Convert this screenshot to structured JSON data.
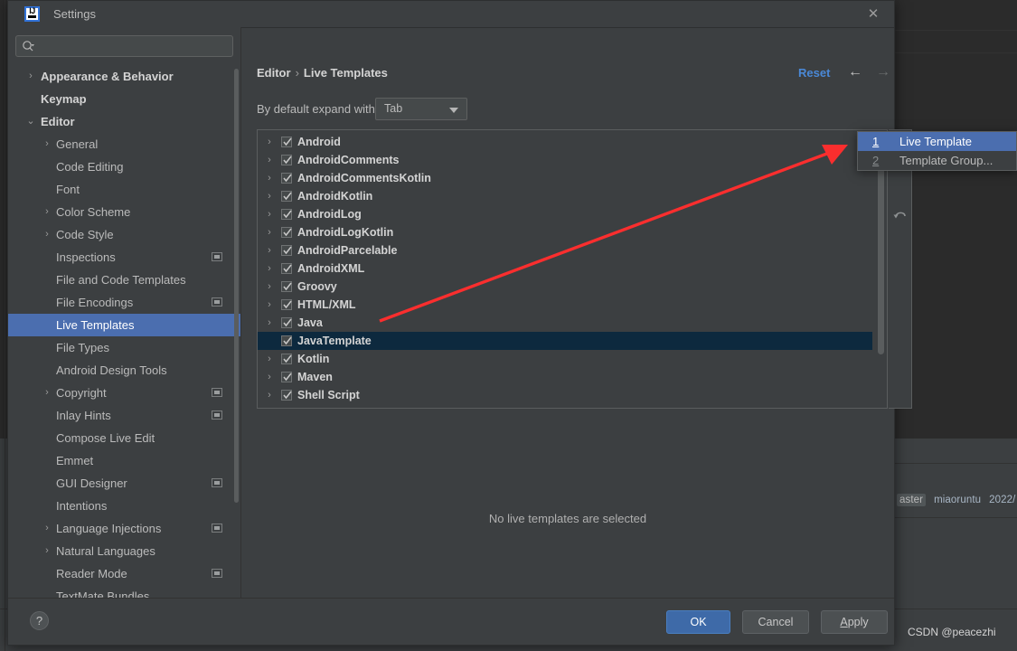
{
  "window": {
    "title": "Settings",
    "logo_text": "IJ",
    "close_icon": "✕"
  },
  "search": {
    "value": "",
    "placeholder": ""
  },
  "sidebar": {
    "items": [
      {
        "label": "Appearance & Behavior",
        "level": 0,
        "arrow": "›",
        "badge": false,
        "selected": false
      },
      {
        "label": "Keymap",
        "level": 0,
        "arrow": "",
        "badge": false,
        "selected": false
      },
      {
        "label": "Editor",
        "level": 0,
        "arrow": "⌄",
        "badge": false,
        "selected": false
      },
      {
        "label": "General",
        "level": 1,
        "arrow": "›",
        "badge": false,
        "selected": false
      },
      {
        "label": "Code Editing",
        "level": 1,
        "arrow": "",
        "badge": false,
        "selected": false
      },
      {
        "label": "Font",
        "level": 1,
        "arrow": "",
        "badge": false,
        "selected": false
      },
      {
        "label": "Color Scheme",
        "level": 1,
        "arrow": "›",
        "badge": false,
        "selected": false
      },
      {
        "label": "Code Style",
        "level": 1,
        "arrow": "›",
        "badge": false,
        "selected": false
      },
      {
        "label": "Inspections",
        "level": 1,
        "arrow": "",
        "badge": true,
        "selected": false
      },
      {
        "label": "File and Code Templates",
        "level": 1,
        "arrow": "",
        "badge": false,
        "selected": false
      },
      {
        "label": "File Encodings",
        "level": 1,
        "arrow": "",
        "badge": true,
        "selected": false
      },
      {
        "label": "Live Templates",
        "level": 1,
        "arrow": "",
        "badge": false,
        "selected": true
      },
      {
        "label": "File Types",
        "level": 1,
        "arrow": "",
        "badge": false,
        "selected": false
      },
      {
        "label": "Android Design Tools",
        "level": 1,
        "arrow": "",
        "badge": false,
        "selected": false
      },
      {
        "label": "Copyright",
        "level": 1,
        "arrow": "›",
        "badge": true,
        "selected": false
      },
      {
        "label": "Inlay Hints",
        "level": 1,
        "arrow": "",
        "badge": true,
        "selected": false
      },
      {
        "label": "Compose Live Edit",
        "level": 1,
        "arrow": "",
        "badge": false,
        "selected": false
      },
      {
        "label": "Emmet",
        "level": 1,
        "arrow": "",
        "badge": false,
        "selected": false
      },
      {
        "label": "GUI Designer",
        "level": 1,
        "arrow": "",
        "badge": true,
        "selected": false
      },
      {
        "label": "Intentions",
        "level": 1,
        "arrow": "",
        "badge": false,
        "selected": false
      },
      {
        "label": "Language Injections",
        "level": 1,
        "arrow": "›",
        "badge": true,
        "selected": false
      },
      {
        "label": "Natural Languages",
        "level": 1,
        "arrow": "›",
        "badge": false,
        "selected": false
      },
      {
        "label": "Reader Mode",
        "level": 1,
        "arrow": "",
        "badge": true,
        "selected": false
      },
      {
        "label": "TextMate Bundles",
        "level": 1,
        "arrow": "",
        "badge": false,
        "selected": false
      }
    ]
  },
  "content": {
    "breadcrumb": {
      "parent": "Editor",
      "separator": "›",
      "current": "Live Templates"
    },
    "reset_label": "Reset",
    "nav_back_icon": "←",
    "nav_forward_icon": "→",
    "expand_label": "By default expand with",
    "expand_value": "Tab",
    "empty_message": "No live templates are selected",
    "toolbar": {
      "add_icon": "add-icon",
      "revert_icon": "revert-icon"
    },
    "templates": [
      {
        "name": "Android",
        "checked": true,
        "expandable": true,
        "selected": false
      },
      {
        "name": "AndroidComments",
        "checked": true,
        "expandable": true,
        "selected": false
      },
      {
        "name": "AndroidCommentsKotlin",
        "checked": true,
        "expandable": true,
        "selected": false
      },
      {
        "name": "AndroidKotlin",
        "checked": true,
        "expandable": true,
        "selected": false
      },
      {
        "name": "AndroidLog",
        "checked": true,
        "expandable": true,
        "selected": false
      },
      {
        "name": "AndroidLogKotlin",
        "checked": true,
        "expandable": true,
        "selected": false
      },
      {
        "name": "AndroidParcelable",
        "checked": true,
        "expandable": true,
        "selected": false
      },
      {
        "name": "AndroidXML",
        "checked": true,
        "expandable": true,
        "selected": false
      },
      {
        "name": "Groovy",
        "checked": true,
        "expandable": true,
        "selected": false
      },
      {
        "name": "HTML/XML",
        "checked": true,
        "expandable": true,
        "selected": false
      },
      {
        "name": "Java",
        "checked": true,
        "expandable": true,
        "selected": false
      },
      {
        "name": "JavaTemplate",
        "checked": true,
        "expandable": false,
        "selected": true
      },
      {
        "name": "Kotlin",
        "checked": true,
        "expandable": true,
        "selected": false
      },
      {
        "name": "Maven",
        "checked": true,
        "expandable": true,
        "selected": false
      },
      {
        "name": "Shell Script",
        "checked": true,
        "expandable": true,
        "selected": false
      }
    ]
  },
  "popup_menu": {
    "items": [
      {
        "mnemonic": "1",
        "label": "Live Template",
        "highlighted": true
      },
      {
        "mnemonic": "2",
        "label": "Template Group...",
        "highlighted": false
      }
    ]
  },
  "footer": {
    "help_label": "?",
    "ok_label": "OK",
    "cancel_label": "Cancel",
    "apply_label_prefix": "",
    "apply_label_underlined": "A",
    "apply_label_suffix": "pply"
  },
  "background": {
    "status_branch": "aster",
    "status_user": "miaoruntu",
    "status_date": "2022/",
    "watermark": "CSDN @peacezhi"
  },
  "colors": {
    "dialog_bg": "#3c3f41",
    "editor_bg": "#2b2b2b",
    "accent_blue": "#4b6eaf",
    "link_blue": "#4a88d6",
    "selection_navy": "#0d293e",
    "annotation_red": "#fa2e2e"
  }
}
